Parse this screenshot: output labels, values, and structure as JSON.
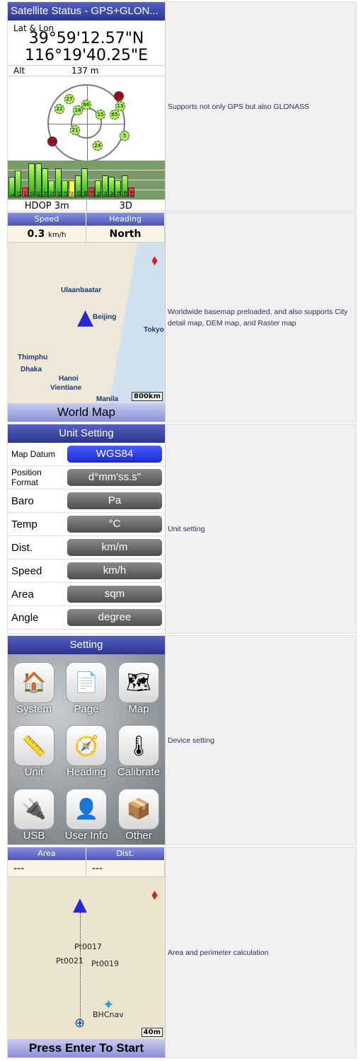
{
  "rows": [
    {
      "caption": "Supports not only GPS but also GLONASS"
    },
    {
      "caption": "Worldwide basemap preloaded, and also supports City detail map, DEM map, and Raster map"
    },
    {
      "caption": "Unit setting"
    },
    {
      "caption": "Device setting"
    },
    {
      "caption": "Area and perimeter calculation"
    }
  ],
  "satellite": {
    "title": "Satellite Status - GPS+GLON...",
    "latlon_label": "Lat & Lon",
    "lat": "39°59'12.57\"N",
    "lon": "116°19'40.25\"E",
    "alt_label": "Alt",
    "alt": "137 m",
    "hdop": "HDOP 3m",
    "fix": "3D",
    "sky": [
      {
        "id": "27",
        "c": "g"
      },
      {
        "id": "22",
        "c": "g"
      },
      {
        "id": "18",
        "c": "g"
      },
      {
        "id": "66",
        "c": "g"
      },
      {
        "id": "28",
        "c": "r"
      },
      {
        "id": "13",
        "c": "g"
      },
      {
        "id": "15",
        "c": "g"
      },
      {
        "id": "65",
        "c": "g"
      },
      {
        "id": "21",
        "c": "g"
      },
      {
        "id": "14",
        "c": "r"
      },
      {
        "id": "5",
        "c": "g"
      },
      {
        "id": "24",
        "c": "g"
      }
    ],
    "bars": [
      {
        "id": "5",
        "v": 0.6,
        "c": "g"
      },
      {
        "id": "13",
        "v": 0.8,
        "c": "g"
      },
      {
        "id": "14",
        "v": 0.3,
        "c": "r"
      },
      {
        "id": "15",
        "v": 1,
        "c": "g"
      },
      {
        "id": "18",
        "v": 1,
        "c": "g"
      },
      {
        "id": "21",
        "v": 0.85,
        "c": "g"
      },
      {
        "id": "22",
        "v": 0.5,
        "c": "g"
      },
      {
        "id": "24",
        "v": 0.85,
        "c": "g"
      },
      {
        "id": "27",
        "v": 0.5,
        "c": "g"
      },
      {
        "id": "28",
        "v": 0.5,
        "c": "y"
      },
      {
        "id": "65",
        "v": 0.65,
        "c": "g"
      },
      {
        "id": "66",
        "v": 0.85,
        "c": "g"
      },
      {
        "id": "67",
        "v": 0.3,
        "c": "r"
      },
      {
        "id": "74",
        "v": 0.5,
        "c": "g"
      },
      {
        "id": "75",
        "v": 0.65,
        "c": "g"
      },
      {
        "id": "76",
        "v": 0.6,
        "c": "g"
      },
      {
        "id": "81",
        "v": 0.5,
        "c": "g"
      },
      {
        "id": "82",
        "v": 0.65,
        "c": "g"
      },
      {
        "id": "83",
        "v": 0.3,
        "c": "r"
      }
    ]
  },
  "worldmap": {
    "speed_label": "Speed",
    "heading_label": "Heading",
    "speed": "0.3",
    "speed_unit": "km/h",
    "heading": "North",
    "scale": "800km",
    "footer": "World Map",
    "places": [
      "Ulaanbaatar",
      "Beijing",
      "Tokyo",
      "Thimphu",
      "Dhaka",
      "Hanoi",
      "Vientiane",
      "Manila"
    ]
  },
  "units": {
    "title": "Unit Setting",
    "items": [
      {
        "k": "Map Datum",
        "v": "WGS84"
      },
      {
        "k": "Position Format",
        "v": "d°mm'ss.s\""
      },
      {
        "k": "Baro",
        "v": "Pa"
      },
      {
        "k": "Temp",
        "v": "°C"
      },
      {
        "k": "Dist.",
        "v": "km/m"
      },
      {
        "k": "Speed",
        "v": "km/h"
      },
      {
        "k": "Area",
        "v": "sqm"
      },
      {
        "k": "Angle",
        "v": "degree"
      }
    ]
  },
  "settings": {
    "title": "Setting",
    "items": [
      {
        "label": "System",
        "icon": "🏠"
      },
      {
        "label": "Page",
        "icon": "📄"
      },
      {
        "label": "Map",
        "icon": "🗺"
      },
      {
        "label": "Unit",
        "icon": "📏"
      },
      {
        "label": "Heading",
        "icon": "🧭"
      },
      {
        "label": "Calibrate",
        "icon": "🌡"
      },
      {
        "label": "USB",
        "icon": "🔌"
      },
      {
        "label": "User Info",
        "icon": "👤"
      },
      {
        "label": "Other",
        "icon": "📦"
      }
    ]
  },
  "area": {
    "area_label": "Area",
    "dist_label": "Dist.",
    "area": "---",
    "dist": "---",
    "scale": "40m",
    "footer": "Press Enter To Start",
    "waypoints": [
      "Pt0017",
      "Pt0021",
      "Pt0019",
      "BHCnav"
    ]
  }
}
